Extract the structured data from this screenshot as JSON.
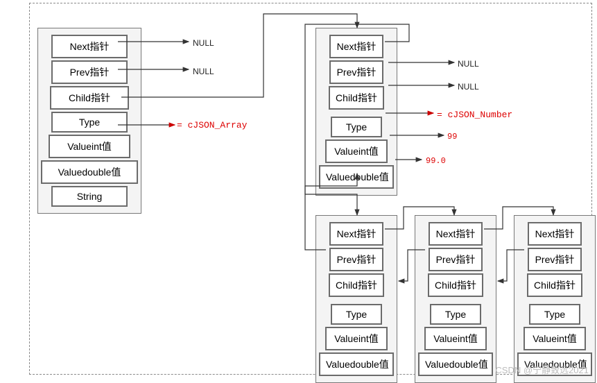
{
  "node1": {
    "cells": [
      "Next指针",
      "Prev指针",
      "Child指针",
      "Type",
      "Valueint值",
      "Valuedouble值",
      "String"
    ]
  },
  "node2": {
    "cells": [
      "Next指针",
      "Prev指针",
      "Child指针",
      "Type",
      "Valueint值",
      "Valuedouble值"
    ]
  },
  "node3": {
    "cells": [
      "Next指针",
      "Prev指针",
      "Child指针",
      "Type",
      "Valueint值",
      "Valuedouble值"
    ]
  },
  "node4": {
    "cells": [
      "Next指针",
      "Prev指针",
      "Child指针",
      "Type",
      "Valueint值",
      "Valuedouble值"
    ]
  },
  "node5": {
    "cells": [
      "Next指针",
      "Prev指针",
      "Child指针",
      "Type",
      "Valueint值",
      "Valuedouble值"
    ]
  },
  "labels": {
    "null1": "NULL",
    "null2": "NULL",
    "null3": "NULL",
    "null4": "NULL",
    "eq_array": "= cJSON_Array",
    "eq_number": "= cJSON_Number",
    "v99": "99",
    "v990": "99.0"
  },
  "watermark": "CSDN @宁静致远2021"
}
